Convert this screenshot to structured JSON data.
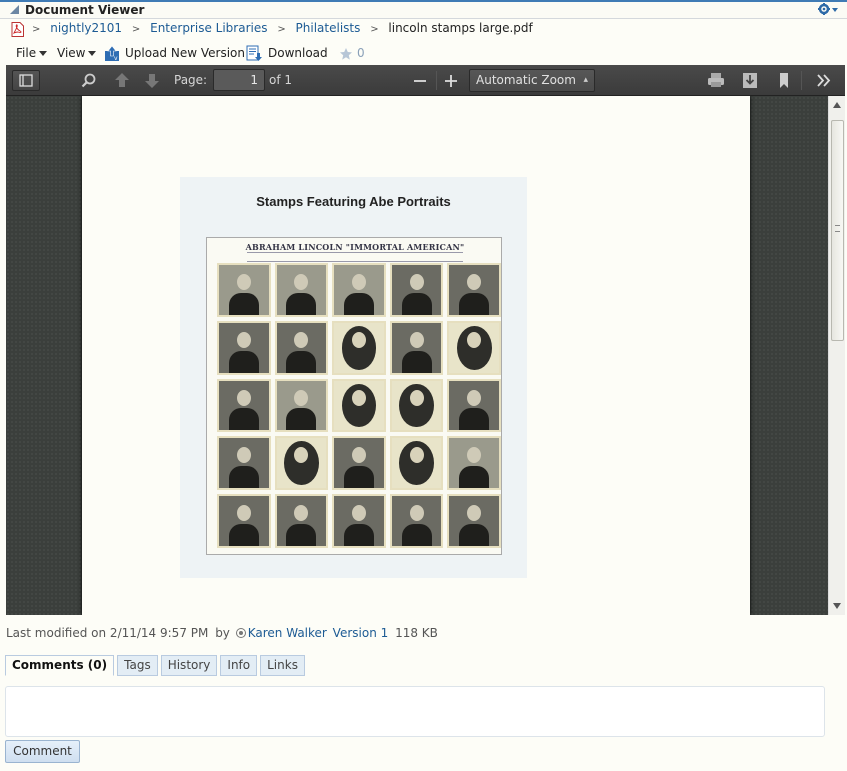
{
  "titlebar": {
    "title": "Document Viewer"
  },
  "breadcrumb": {
    "items": [
      {
        "label": "nightly2101"
      },
      {
        "label": "Enterprise Libraries"
      },
      {
        "label": "Philatelists"
      }
    ],
    "separator": ">",
    "current": "lincoln stamps large.pdf"
  },
  "menubar": {
    "file": "File",
    "view": "View",
    "upload": "Upload New Version",
    "download": "Download",
    "favorites_count": "0"
  },
  "pdf_toolbar": {
    "page_label": "Page:",
    "page_value": "1",
    "page_of": "of 1",
    "zoom": "Automatic Zoom",
    "zoom_minus": "—",
    "zoom_plus": "+"
  },
  "document": {
    "title": "Stamps Featuring Abe Portraits",
    "sheet_header": "ABRAHAM LINCOLN \"IMMORTAL AMERICAN\""
  },
  "meta": {
    "last_modified_prefix": "Last modified on 2/11/14 9:57 PM",
    "by": "by",
    "author": "Karen Walker",
    "version": "Version 1",
    "size": "118 KB"
  },
  "tabs": [
    {
      "label": "Comments (0)",
      "active": true
    },
    {
      "label": "Tags",
      "active": false
    },
    {
      "label": "History",
      "active": false
    },
    {
      "label": "Info",
      "active": false
    },
    {
      "label": "Links",
      "active": false
    }
  ],
  "comment": {
    "button": "Comment",
    "placeholder": ""
  },
  "colors": {
    "accent": "#3f7bb5",
    "link": "#1d5b94",
    "toolbar": "#444444"
  }
}
